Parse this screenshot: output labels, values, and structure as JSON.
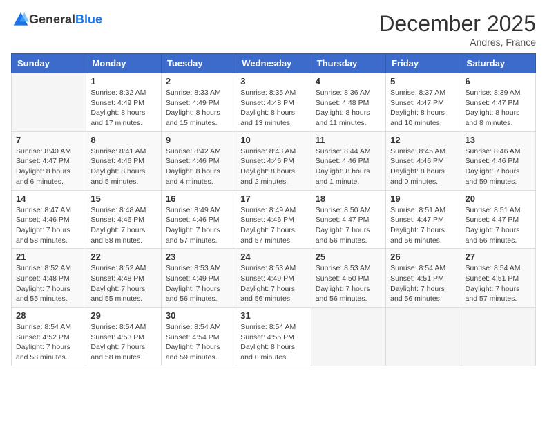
{
  "logo": {
    "text_general": "General",
    "text_blue": "Blue"
  },
  "title": "December 2025",
  "location": "Andres, France",
  "days_of_week": [
    "Sunday",
    "Monday",
    "Tuesday",
    "Wednesday",
    "Thursday",
    "Friday",
    "Saturday"
  ],
  "weeks": [
    [
      {
        "day": "",
        "sunrise": "",
        "sunset": "",
        "daylight": ""
      },
      {
        "day": "1",
        "sunrise": "Sunrise: 8:32 AM",
        "sunset": "Sunset: 4:49 PM",
        "daylight": "Daylight: 8 hours and 17 minutes."
      },
      {
        "day": "2",
        "sunrise": "Sunrise: 8:33 AM",
        "sunset": "Sunset: 4:49 PM",
        "daylight": "Daylight: 8 hours and 15 minutes."
      },
      {
        "day": "3",
        "sunrise": "Sunrise: 8:35 AM",
        "sunset": "Sunset: 4:48 PM",
        "daylight": "Daylight: 8 hours and 13 minutes."
      },
      {
        "day": "4",
        "sunrise": "Sunrise: 8:36 AM",
        "sunset": "Sunset: 4:48 PM",
        "daylight": "Daylight: 8 hours and 11 minutes."
      },
      {
        "day": "5",
        "sunrise": "Sunrise: 8:37 AM",
        "sunset": "Sunset: 4:47 PM",
        "daylight": "Daylight: 8 hours and 10 minutes."
      },
      {
        "day": "6",
        "sunrise": "Sunrise: 8:39 AM",
        "sunset": "Sunset: 4:47 PM",
        "daylight": "Daylight: 8 hours and 8 minutes."
      }
    ],
    [
      {
        "day": "7",
        "sunrise": "Sunrise: 8:40 AM",
        "sunset": "Sunset: 4:47 PM",
        "daylight": "Daylight: 8 hours and 6 minutes."
      },
      {
        "day": "8",
        "sunrise": "Sunrise: 8:41 AM",
        "sunset": "Sunset: 4:46 PM",
        "daylight": "Daylight: 8 hours and 5 minutes."
      },
      {
        "day": "9",
        "sunrise": "Sunrise: 8:42 AM",
        "sunset": "Sunset: 4:46 PM",
        "daylight": "Daylight: 8 hours and 4 minutes."
      },
      {
        "day": "10",
        "sunrise": "Sunrise: 8:43 AM",
        "sunset": "Sunset: 4:46 PM",
        "daylight": "Daylight: 8 hours and 2 minutes."
      },
      {
        "day": "11",
        "sunrise": "Sunrise: 8:44 AM",
        "sunset": "Sunset: 4:46 PM",
        "daylight": "Daylight: 8 hours and 1 minute."
      },
      {
        "day": "12",
        "sunrise": "Sunrise: 8:45 AM",
        "sunset": "Sunset: 4:46 PM",
        "daylight": "Daylight: 8 hours and 0 minutes."
      },
      {
        "day": "13",
        "sunrise": "Sunrise: 8:46 AM",
        "sunset": "Sunset: 4:46 PM",
        "daylight": "Daylight: 7 hours and 59 minutes."
      }
    ],
    [
      {
        "day": "14",
        "sunrise": "Sunrise: 8:47 AM",
        "sunset": "Sunset: 4:46 PM",
        "daylight": "Daylight: 7 hours and 58 minutes."
      },
      {
        "day": "15",
        "sunrise": "Sunrise: 8:48 AM",
        "sunset": "Sunset: 4:46 PM",
        "daylight": "Daylight: 7 hours and 58 minutes."
      },
      {
        "day": "16",
        "sunrise": "Sunrise: 8:49 AM",
        "sunset": "Sunset: 4:46 PM",
        "daylight": "Daylight: 7 hours and 57 minutes."
      },
      {
        "day": "17",
        "sunrise": "Sunrise: 8:49 AM",
        "sunset": "Sunset: 4:46 PM",
        "daylight": "Daylight: 7 hours and 57 minutes."
      },
      {
        "day": "18",
        "sunrise": "Sunrise: 8:50 AM",
        "sunset": "Sunset: 4:47 PM",
        "daylight": "Daylight: 7 hours and 56 minutes."
      },
      {
        "day": "19",
        "sunrise": "Sunrise: 8:51 AM",
        "sunset": "Sunset: 4:47 PM",
        "daylight": "Daylight: 7 hours and 56 minutes."
      },
      {
        "day": "20",
        "sunrise": "Sunrise: 8:51 AM",
        "sunset": "Sunset: 4:47 PM",
        "daylight": "Daylight: 7 hours and 56 minutes."
      }
    ],
    [
      {
        "day": "21",
        "sunrise": "Sunrise: 8:52 AM",
        "sunset": "Sunset: 4:48 PM",
        "daylight": "Daylight: 7 hours and 55 minutes."
      },
      {
        "day": "22",
        "sunrise": "Sunrise: 8:52 AM",
        "sunset": "Sunset: 4:48 PM",
        "daylight": "Daylight: 7 hours and 55 minutes."
      },
      {
        "day": "23",
        "sunrise": "Sunrise: 8:53 AM",
        "sunset": "Sunset: 4:49 PM",
        "daylight": "Daylight: 7 hours and 56 minutes."
      },
      {
        "day": "24",
        "sunrise": "Sunrise: 8:53 AM",
        "sunset": "Sunset: 4:49 PM",
        "daylight": "Daylight: 7 hours and 56 minutes."
      },
      {
        "day": "25",
        "sunrise": "Sunrise: 8:53 AM",
        "sunset": "Sunset: 4:50 PM",
        "daylight": "Daylight: 7 hours and 56 minutes."
      },
      {
        "day": "26",
        "sunrise": "Sunrise: 8:54 AM",
        "sunset": "Sunset: 4:51 PM",
        "daylight": "Daylight: 7 hours and 56 minutes."
      },
      {
        "day": "27",
        "sunrise": "Sunrise: 8:54 AM",
        "sunset": "Sunset: 4:51 PM",
        "daylight": "Daylight: 7 hours and 57 minutes."
      }
    ],
    [
      {
        "day": "28",
        "sunrise": "Sunrise: 8:54 AM",
        "sunset": "Sunset: 4:52 PM",
        "daylight": "Daylight: 7 hours and 58 minutes."
      },
      {
        "day": "29",
        "sunrise": "Sunrise: 8:54 AM",
        "sunset": "Sunset: 4:53 PM",
        "daylight": "Daylight: 7 hours and 58 minutes."
      },
      {
        "day": "30",
        "sunrise": "Sunrise: 8:54 AM",
        "sunset": "Sunset: 4:54 PM",
        "daylight": "Daylight: 7 hours and 59 minutes."
      },
      {
        "day": "31",
        "sunrise": "Sunrise: 8:54 AM",
        "sunset": "Sunset: 4:55 PM",
        "daylight": "Daylight: 8 hours and 0 minutes."
      },
      {
        "day": "",
        "sunrise": "",
        "sunset": "",
        "daylight": ""
      },
      {
        "day": "",
        "sunrise": "",
        "sunset": "",
        "daylight": ""
      },
      {
        "day": "",
        "sunrise": "",
        "sunset": "",
        "daylight": ""
      }
    ]
  ]
}
